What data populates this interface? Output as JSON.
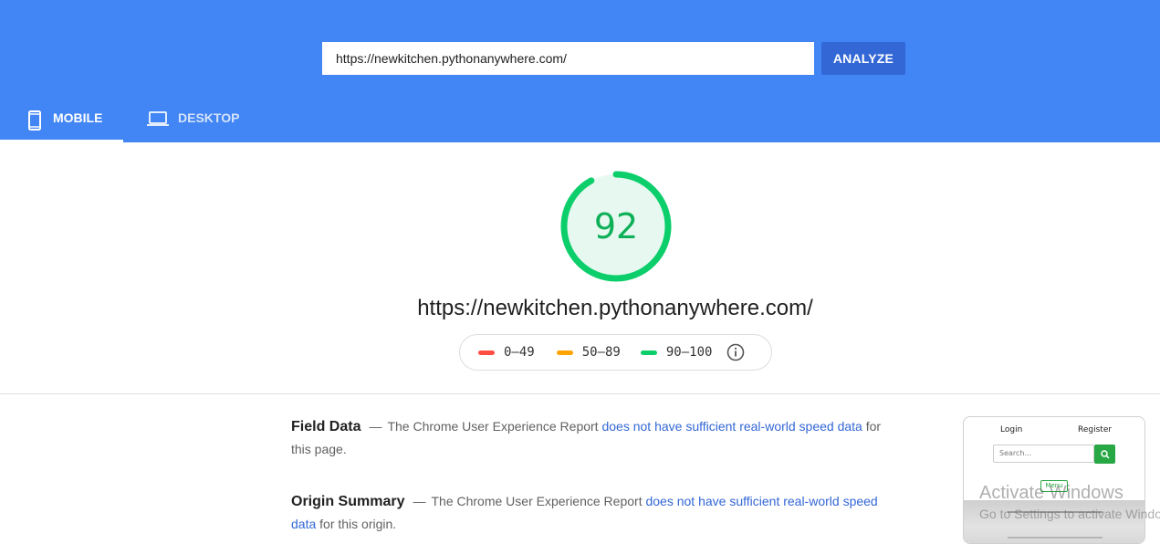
{
  "header": {
    "url_input_value": "https://newkitchen.pythonanywhere.com/",
    "analyze_label": "ANALYZE",
    "tabs": [
      {
        "label": "MOBILE",
        "icon": "smartphone-icon",
        "active": true
      },
      {
        "label": "DESKTOP",
        "icon": "laptop-icon",
        "active": false
      }
    ]
  },
  "colors": {
    "header_bg": "#4285f4",
    "analyze_bg": "#3367d6",
    "score_good": "#0cce6b",
    "score_average": "#ffa400",
    "score_poor": "#ff4e42",
    "link": "#3367d6"
  },
  "score": {
    "value": "92",
    "fraction": 0.92
  },
  "tested_url": "https://newkitchen.pythonanywhere.com/",
  "legend": {
    "items": [
      {
        "range": "0–49",
        "color": "#ff4e42"
      },
      {
        "range": "50–89",
        "color": "#ffa400"
      },
      {
        "range": "90–100",
        "color": "#0cce6b"
      }
    ],
    "info_icon": "info-icon"
  },
  "field_data": {
    "title": "Field Data",
    "dash": "—",
    "text_before": "The Chrome User Experience Report",
    "link_text": "does not have sufficient real-world speed data",
    "text_after": "for this page."
  },
  "origin_summary": {
    "title": "Origin Summary",
    "dash": "—",
    "text_before": "The Chrome User Experience Report",
    "link_text": "does not have sufficient real-world speed data",
    "text_after": "for this origin."
  },
  "thumbnail": {
    "login": "Login",
    "register": "Register",
    "search_placeholder": "Search...",
    "menu": "Menu"
  },
  "watermark": {
    "title": "Activate Windows",
    "subtitle": "Go to Settings to activate Windows."
  }
}
